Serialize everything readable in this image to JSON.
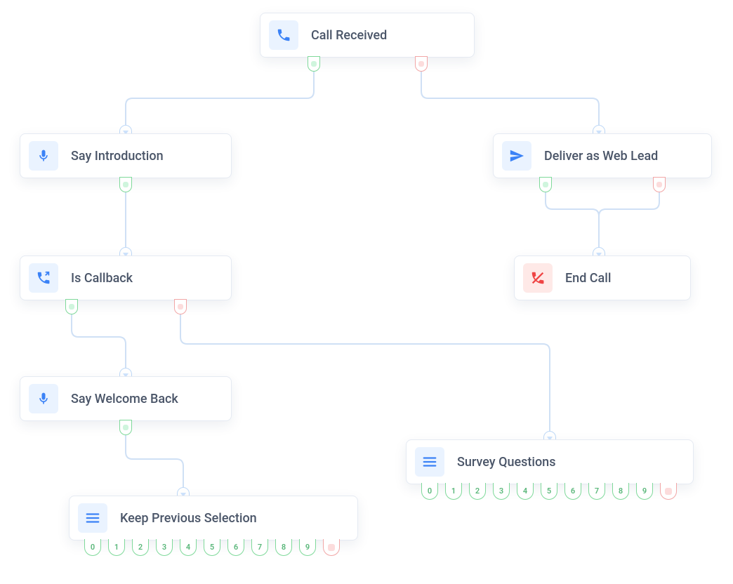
{
  "nodes": {
    "call_received": {
      "label": "Call Received",
      "icon": "phone",
      "icon_color": "#3B82F6",
      "icon_bg": "blue"
    },
    "say_intro": {
      "label": "Say Introduction",
      "icon": "microphone",
      "icon_color": "#3B82F6",
      "icon_bg": "blue"
    },
    "deliver_web_lead": {
      "label": "Deliver as Web Lead",
      "icon": "paper-plane",
      "icon_color": "#3B82F6",
      "icon_bg": "blue"
    },
    "is_callback": {
      "label": "Is Callback",
      "icon": "callback",
      "icon_color": "#3B82F6",
      "icon_bg": "blue"
    },
    "end_call": {
      "label": "End Call",
      "icon": "phone-off",
      "icon_color": "#EF4444",
      "icon_bg": "red"
    },
    "say_welcome_back": {
      "label": "Say Welcome Back",
      "icon": "microphone",
      "icon_color": "#3B82F6",
      "icon_bg": "blue"
    },
    "survey_questions": {
      "label": "Survey Questions",
      "icon": "menu",
      "icon_color": "#3B82F6",
      "icon_bg": "blue"
    },
    "keep_prev_selection": {
      "label": "Keep Previous Selection",
      "icon": "menu",
      "icon_color": "#3B82F6",
      "icon_bg": "blue"
    }
  },
  "port_indices": [
    "0",
    "1",
    "2",
    "3",
    "4",
    "5",
    "6",
    "7",
    "8",
    "9"
  ],
  "edges": [
    {
      "from": "call_received",
      "port": "success",
      "to": "say_intro"
    },
    {
      "from": "call_received",
      "port": "fail",
      "to": "deliver_web_lead"
    },
    {
      "from": "say_intro",
      "port": "success",
      "to": "is_callback"
    },
    {
      "from": "deliver_web_lead",
      "port": "success",
      "to": "end_call"
    },
    {
      "from": "deliver_web_lead",
      "port": "fail",
      "to": "end_call"
    },
    {
      "from": "is_callback",
      "port": "success",
      "to": "say_welcome_back"
    },
    {
      "from": "is_callback",
      "port": "fail",
      "to": "survey_questions"
    },
    {
      "from": "say_welcome_back",
      "port": "success",
      "to": "keep_prev_selection"
    }
  ],
  "colors": {
    "connector": "#CFE0F5",
    "port_success": "#7FD99A",
    "port_fail": "#F2A6A6",
    "node_border": "#E5EAF2",
    "text": "#4A5568",
    "icon_bg_blue": "#EAF3FF",
    "icon_bg_red": "#FEE9E7"
  }
}
